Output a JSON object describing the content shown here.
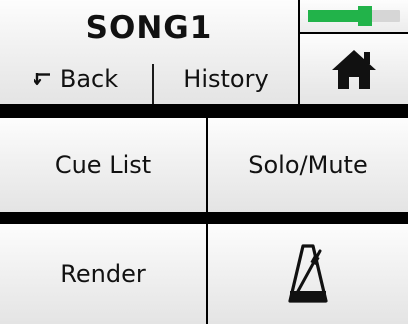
{
  "header": {
    "title": "SONG1",
    "back_label": "Back",
    "history_label": "History"
  },
  "meter": {
    "level": 0.62,
    "peak": 0.62,
    "color": "#22b34a"
  },
  "home": {
    "icon": "home-icon"
  },
  "buttons": {
    "cue_list": "Cue List",
    "solo_mute": "Solo/Mute",
    "render": "Render",
    "metronome_icon": "metronome-icon"
  }
}
